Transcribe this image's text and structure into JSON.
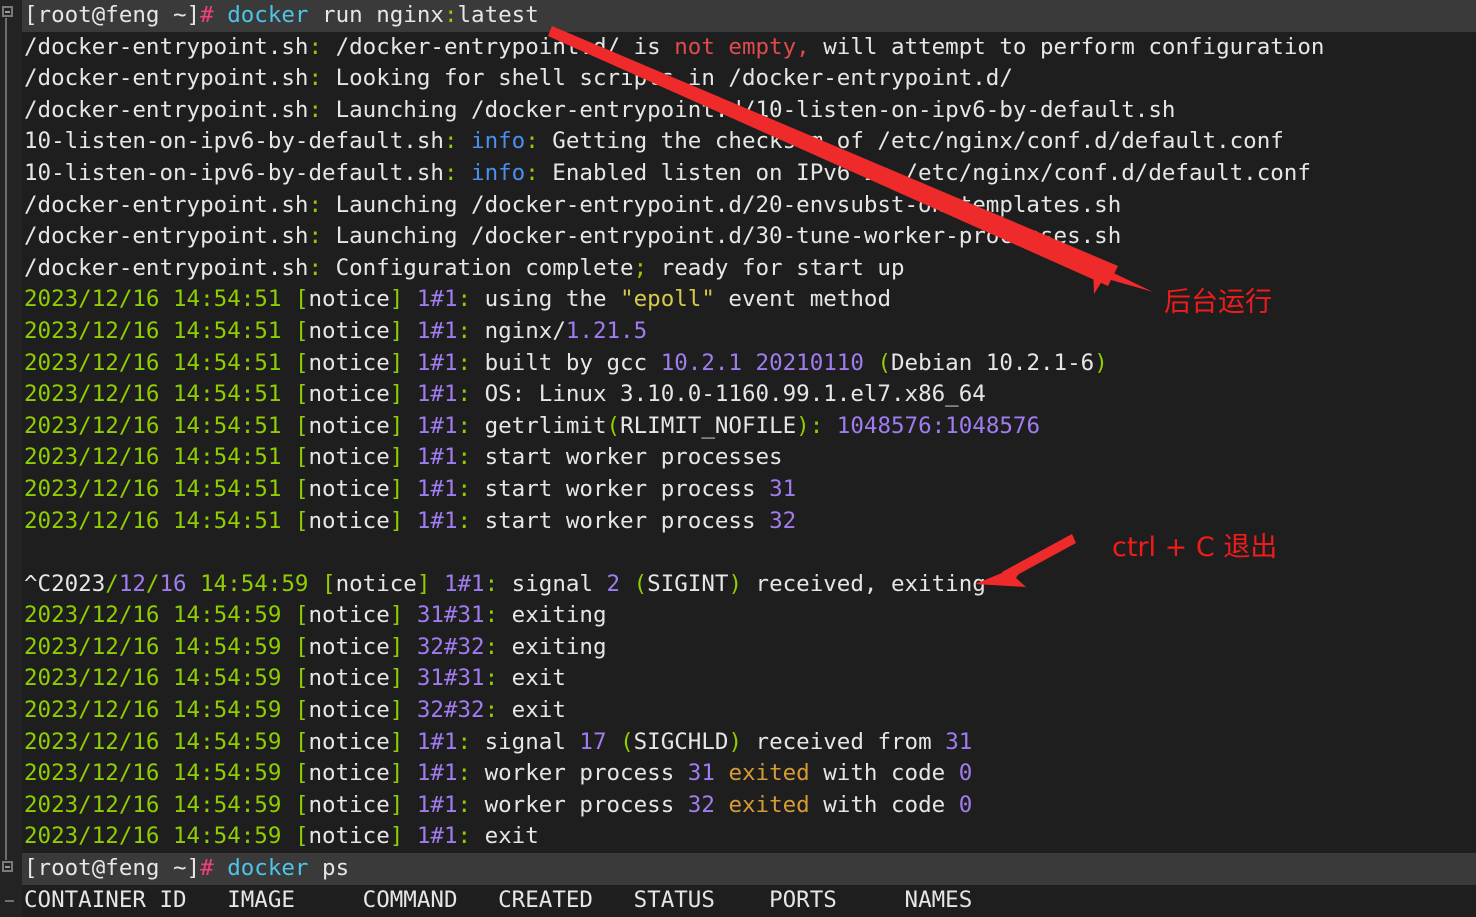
{
  "terminal": {
    "prompt": {
      "user_host": "[root@feng ~]",
      "hash": "#",
      "command_1": "docker",
      "args_1": " run nginx",
      "colon_1": ":",
      "tag_1": "latest",
      "command_2": "docker",
      "args_2": " ps"
    },
    "lines": [
      "[root@feng ~]# docker run nginx:latest",
      "/docker-entrypoint.sh: /docker-entrypoint.d/ is not empty, will attempt to perform configuration",
      "/docker-entrypoint.sh: Looking for shell scripts in /docker-entrypoint.d/",
      "/docker-entrypoint.sh: Launching /docker-entrypoint.d/10-listen-on-ipv6-by-default.sh",
      "10-listen-on-ipv6-by-default.sh: info: Getting the checksum of /etc/nginx/conf.d/default.conf",
      "10-listen-on-ipv6-by-default.sh: info: Enabled listen on IPv6 in /etc/nginx/conf.d/default.conf",
      "/docker-entrypoint.sh: Launching /docker-entrypoint.d/20-envsubst-on-templates.sh",
      "/docker-entrypoint.sh: Launching /docker-entrypoint.d/30-tune-worker-processes.sh",
      "/docker-entrypoint.sh: Configuration complete; ready for start up",
      "2023/12/16 14:54:51 [notice] 1#1: using the \"epoll\" event method",
      "2023/12/16 14:54:51 [notice] 1#1: nginx/1.21.5",
      "2023/12/16 14:54:51 [notice] 1#1: built by gcc 10.2.1 20210110 (Debian 10.2.1-6)",
      "2023/12/16 14:54:51 [notice] 1#1: OS: Linux 3.10.0-1160.99.1.el7.x86_64",
      "2023/12/16 14:54:51 [notice] 1#1: getrlimit(RLIMIT_NOFILE): 1048576:1048576",
      "2023/12/16 14:54:51 [notice] 1#1: start worker processes",
      "2023/12/16 14:54:51 [notice] 1#1: start worker process 31",
      "2023/12/16 14:54:51 [notice] 1#1: start worker process 32",
      "",
      "^C2023/12/16 14:54:59 [notice] 1#1: signal 2 (SIGINT) received, exiting",
      "2023/12/16 14:54:59 [notice] 31#31: exiting",
      "2023/12/16 14:54:59 [notice] 32#32: exiting",
      "2023/12/16 14:54:59 [notice] 31#31: exit",
      "2023/12/16 14:54:59 [notice] 32#32: exit",
      "2023/12/16 14:54:59 [notice] 1#1: signal 17 (SIGCHLD) received from 31",
      "2023/12/16 14:54:59 [notice] 1#1: worker process 31 exited with code 0",
      "2023/12/16 14:54:59 [notice] 1#1: worker process 32 exited with code 0",
      "2023/12/16 14:54:59 [notice] 1#1: exit",
      "[root@feng ~]# docker ps",
      "CONTAINER ID   IMAGE     COMMAND   CREATED   STATUS    PORTS     NAMES"
    ],
    "entrypoint": {
      "script_name": "/docker-entrypoint.sh",
      "colon": ":",
      "msg_not_empty_a": " /docker-entrypoint.d/ is ",
      "msg_not_empty_red": "not empty,",
      "msg_not_empty_b": " will attempt to perform configuration",
      "msg_looking": " Looking for shell scripts in /docker-entrypoint.d/",
      "msg_launch_10": " Launching /docker-entrypoint.d/10-listen-on-ipv6-by-default.sh",
      "msg_launch_20": " Launching /docker-entrypoint.d/20-envsubst-on-templates.sh",
      "msg_launch_30": " Launching /docker-entrypoint.d/30-tune-worker-processes.sh",
      "msg_config_a": " Configuration complete",
      "msg_config_semi": ";",
      "msg_config_b": " ready for start up"
    },
    "ipv6_script": {
      "name": "10-listen-on-ipv6-by-default.sh",
      "info": "info",
      "msg_checksum": " Getting the checksum of /etc/nginx/conf.d/default.conf",
      "msg_enabled": " Enabled listen on IPv6 in /etc/nginx/conf.d/default.conf"
    },
    "log": {
      "ts_start": "2023/12/16 14:54:51",
      "ts_stop": "2023/12/16 14:54:59",
      "notice_open": "[",
      "notice_word": "notice",
      "notice_close": "]",
      "pid_1": "1#1",
      "pid_31": "31#31",
      "pid_32": "32#32",
      "colon": ":",
      "msg_epoll_a": " using the ",
      "msg_epoll_q": "\"epoll\"",
      "msg_epoll_b": " event method",
      "msg_nginx": " nginx/",
      "nginx_version": "1.21.5",
      "msg_built": " built by gcc ",
      "gcc_version": "10.2.1 20210110",
      "paren_open": "(",
      "debian_text": "Debian 10.2.1-6",
      "paren_close": ")",
      "msg_os": " OS: Linux 3.10.0-1160.99.1.el7.x86_64",
      "msg_getrlimit": " getrlimit",
      "rlimit_name": "RLIMIT_NOFILE",
      "rlimit_values": " 1048576:1048576",
      "msg_start_workers": " start worker processes",
      "msg_start_worker": " start worker process ",
      "worker_31": "31",
      "worker_32": "32",
      "ctrlc": "^C2023",
      "slash": "/",
      "month": "12",
      "day": "16",
      "time_stop": " 14:54:59",
      "msg_signal": " signal ",
      "signal_2": "2",
      "sigint": "SIGINT",
      "msg_received_exiting": " received, exiting",
      "msg_exiting": " exiting",
      "msg_exit": " exit",
      "signal_17": "17",
      "sigchld": "SIGCHLD",
      "msg_received_from": " received from ",
      "msg_worker_proc": " worker process ",
      "msg_exited": "exited",
      "msg_with_code": " with code ",
      "code_0": "0"
    },
    "ps_header": {
      "container_id": "CONTAINER ID",
      "image": "IMAGE",
      "command": "COMMAND",
      "created": "CREATED",
      "status": "STATUS",
      "ports": "PORTS",
      "names": "NAMES"
    }
  },
  "annotations": [
    {
      "label": "后台运行",
      "color": "#f01c1c"
    },
    {
      "label": "ctrl + C 退出",
      "color": "#f01c1c"
    }
  ],
  "colors": {
    "background": "#1e1e1e",
    "highlight_line": "#3a3a3a",
    "gutter": "#232323",
    "text": "#e6e6e6",
    "green": "#8fce00",
    "purple": "#a07cf0",
    "cyan": "#4fc3e8",
    "pink": "#f4407a",
    "red": "#e04b4b",
    "yellow": "#d7c94a",
    "blue": "#4b8ef0",
    "orange": "#d79b36",
    "annotation_red": "#f01c1c"
  }
}
